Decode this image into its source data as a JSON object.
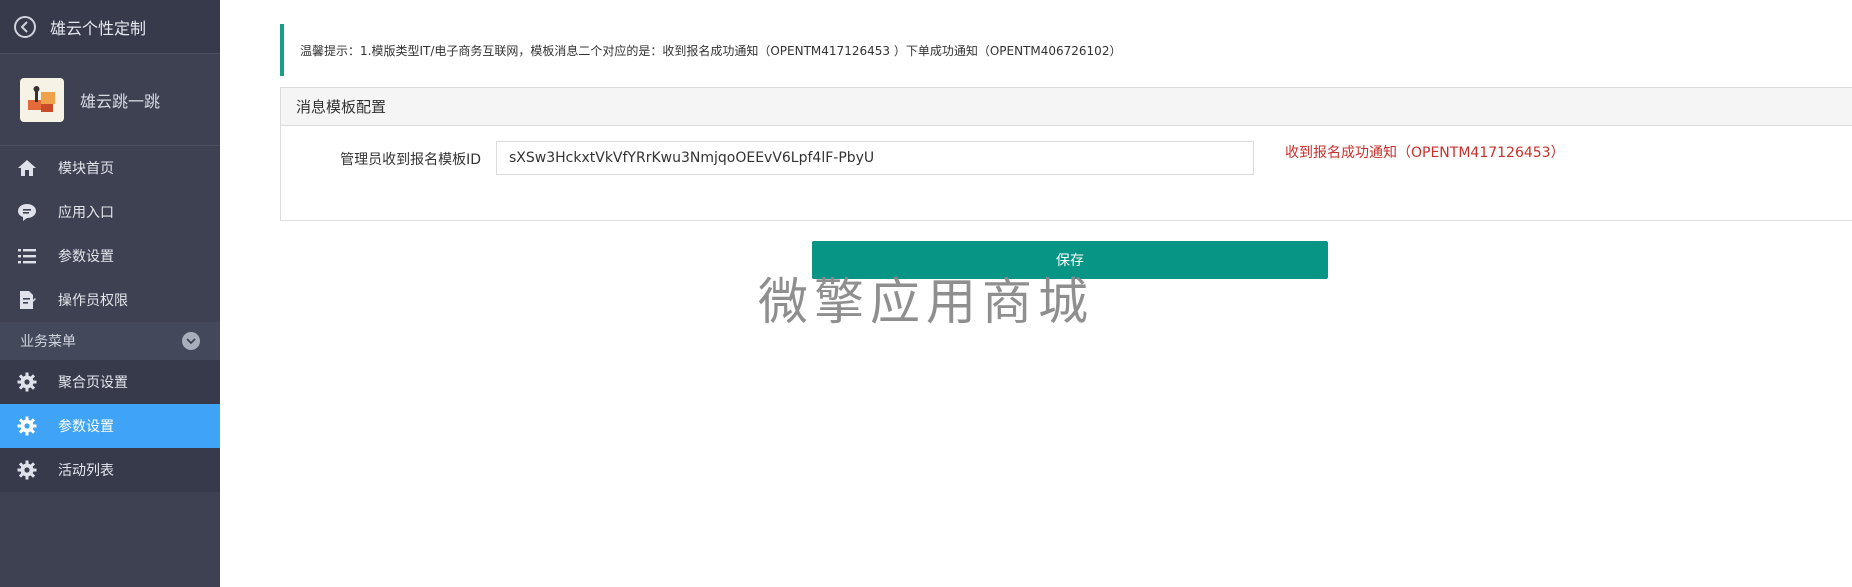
{
  "sidebar": {
    "back_title": "雄云个性定制",
    "app_name": "雄云跳一跳",
    "items": [
      {
        "label": "模块首页",
        "icon": "home-icon"
      },
      {
        "label": "应用入口",
        "icon": "chat-icon"
      },
      {
        "label": "参数设置",
        "icon": "list-icon"
      },
      {
        "label": "操作员权限",
        "icon": "edit-doc-icon"
      }
    ],
    "group": {
      "label": "业务菜单",
      "items": [
        {
          "label": "聚合页设置",
          "icon": "gear-icon",
          "active": false
        },
        {
          "label": "参数设置",
          "icon": "gear-icon",
          "active": true
        },
        {
          "label": "活动列表",
          "icon": "gear-icon",
          "active": false
        }
      ]
    }
  },
  "notice": {
    "text": "温馨提示：1.模版类型IT/电子商务互联网，模板消息二个对应的是：收到报名成功通知（OPENTM417126453 ）下单成功通知（OPENTM406726102）"
  },
  "panel": {
    "title": "消息模板配置",
    "field_label": "管理员收到报名模板ID",
    "field_value": "sXSw3HckxtVkVfYRrKwu3NmjqoOEEvV6Lpf4lF-PbyU",
    "field_hint": "收到报名成功通知（OPENTM417126453）"
  },
  "actions": {
    "save_label": "保存"
  },
  "watermark": "微擎应用商城",
  "colors": {
    "sidebar_bg": "#3d4152",
    "active_item": "#3fa3f6",
    "primary_button": "#079586",
    "notice_border": "#17a085",
    "hint_text": "#c9302c"
  }
}
